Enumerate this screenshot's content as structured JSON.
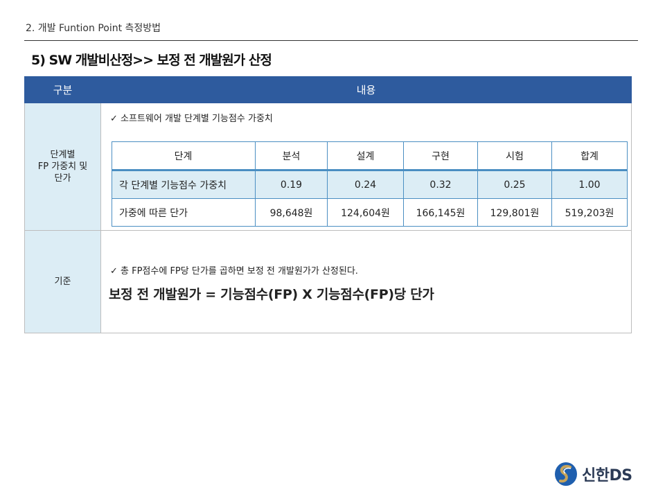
{
  "header": {
    "title": "2. 개발 Funtion Point 측정방법"
  },
  "section": {
    "title": "5) SW 개발비산정>> 보정 전 개발원가 산정"
  },
  "main_table": {
    "col_headers": [
      "구분",
      "내용"
    ],
    "row1": {
      "label_lines": [
        "단계별",
        "FP 가중치 및",
        "단가"
      ],
      "check_text": "✓ 소프트웨어 개발 단계별 기능점수 가중치",
      "inner_table": {
        "headers": [
          "단계",
          "분석",
          "설계",
          "구현",
          "시험",
          "합계"
        ],
        "weights": [
          "각 단계별 기능점수 가중치",
          "0.19",
          "0.24",
          "0.32",
          "0.25",
          "1.00"
        ],
        "prices": [
          "가중에 따른 단가",
          "98,648원",
          "124,604원",
          "166,145원",
          "129,801원",
          "519,203원"
        ]
      }
    },
    "row2": {
      "label": "기준",
      "check_text": "✓ 총 FP점수에 FP당 단가를 곱하면 보정 전 개발원가가 산정된다.",
      "formula": "보정 전 개발원가 = 기능점수(FP) X 기능점수(FP)당 단가"
    }
  },
  "logo": {
    "text": "신한DS",
    "colors": {
      "blue": "#1f5fae",
      "gold": "#c8a45a"
    }
  }
}
